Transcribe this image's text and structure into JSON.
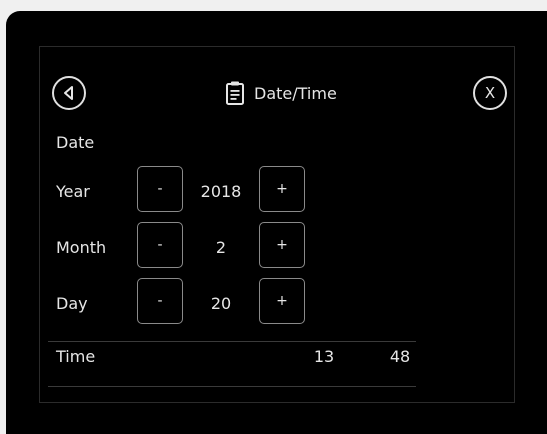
{
  "header": {
    "title": "Date/Time",
    "back_icon": "back-arrow-icon",
    "close_label": "X",
    "title_icon": "clipboard-icon"
  },
  "date": {
    "section_label": "Date",
    "minus_label": "-",
    "plus_label": "+",
    "rows": [
      {
        "label": "Year",
        "value": "2018"
      },
      {
        "label": "Month",
        "value": "2"
      },
      {
        "label": "Day",
        "value": "20"
      }
    ]
  },
  "time": {
    "label": "Time",
    "hour": "13",
    "minute": "48"
  },
  "colors": {
    "background": "#000000",
    "text": "#e6e6e6",
    "button_border": "#8a8a8a"
  }
}
